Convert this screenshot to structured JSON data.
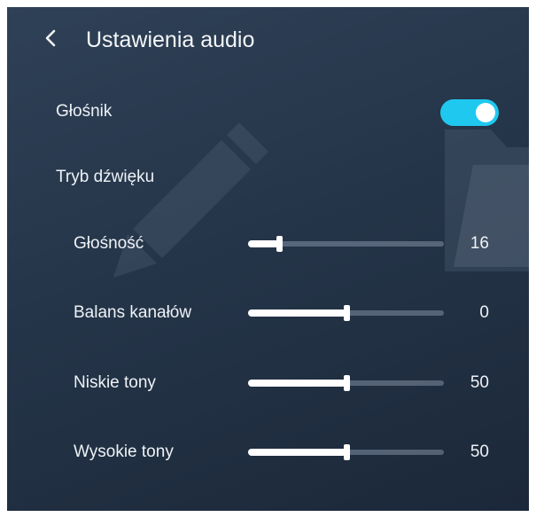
{
  "header": {
    "title": "Ustawienia audio",
    "back_icon": "chevron-left-icon"
  },
  "speaker": {
    "label": "Głośnik",
    "enabled": true,
    "toggle_color": "#1fc8ef"
  },
  "sound_mode": {
    "label": "Tryb dźwięku"
  },
  "sliders": [
    {
      "label": "Głośność",
      "value": "16",
      "fraction": 0.16
    },
    {
      "label": "Balans kanałów",
      "value": "0",
      "fraction": 0.5
    },
    {
      "label": "Niskie tony",
      "value": "50",
      "fraction": 0.5
    },
    {
      "label": "Wysokie tony",
      "value": "50",
      "fraction": 0.5
    }
  ],
  "background_icons": [
    "pencil-icon",
    "folder-icon"
  ]
}
